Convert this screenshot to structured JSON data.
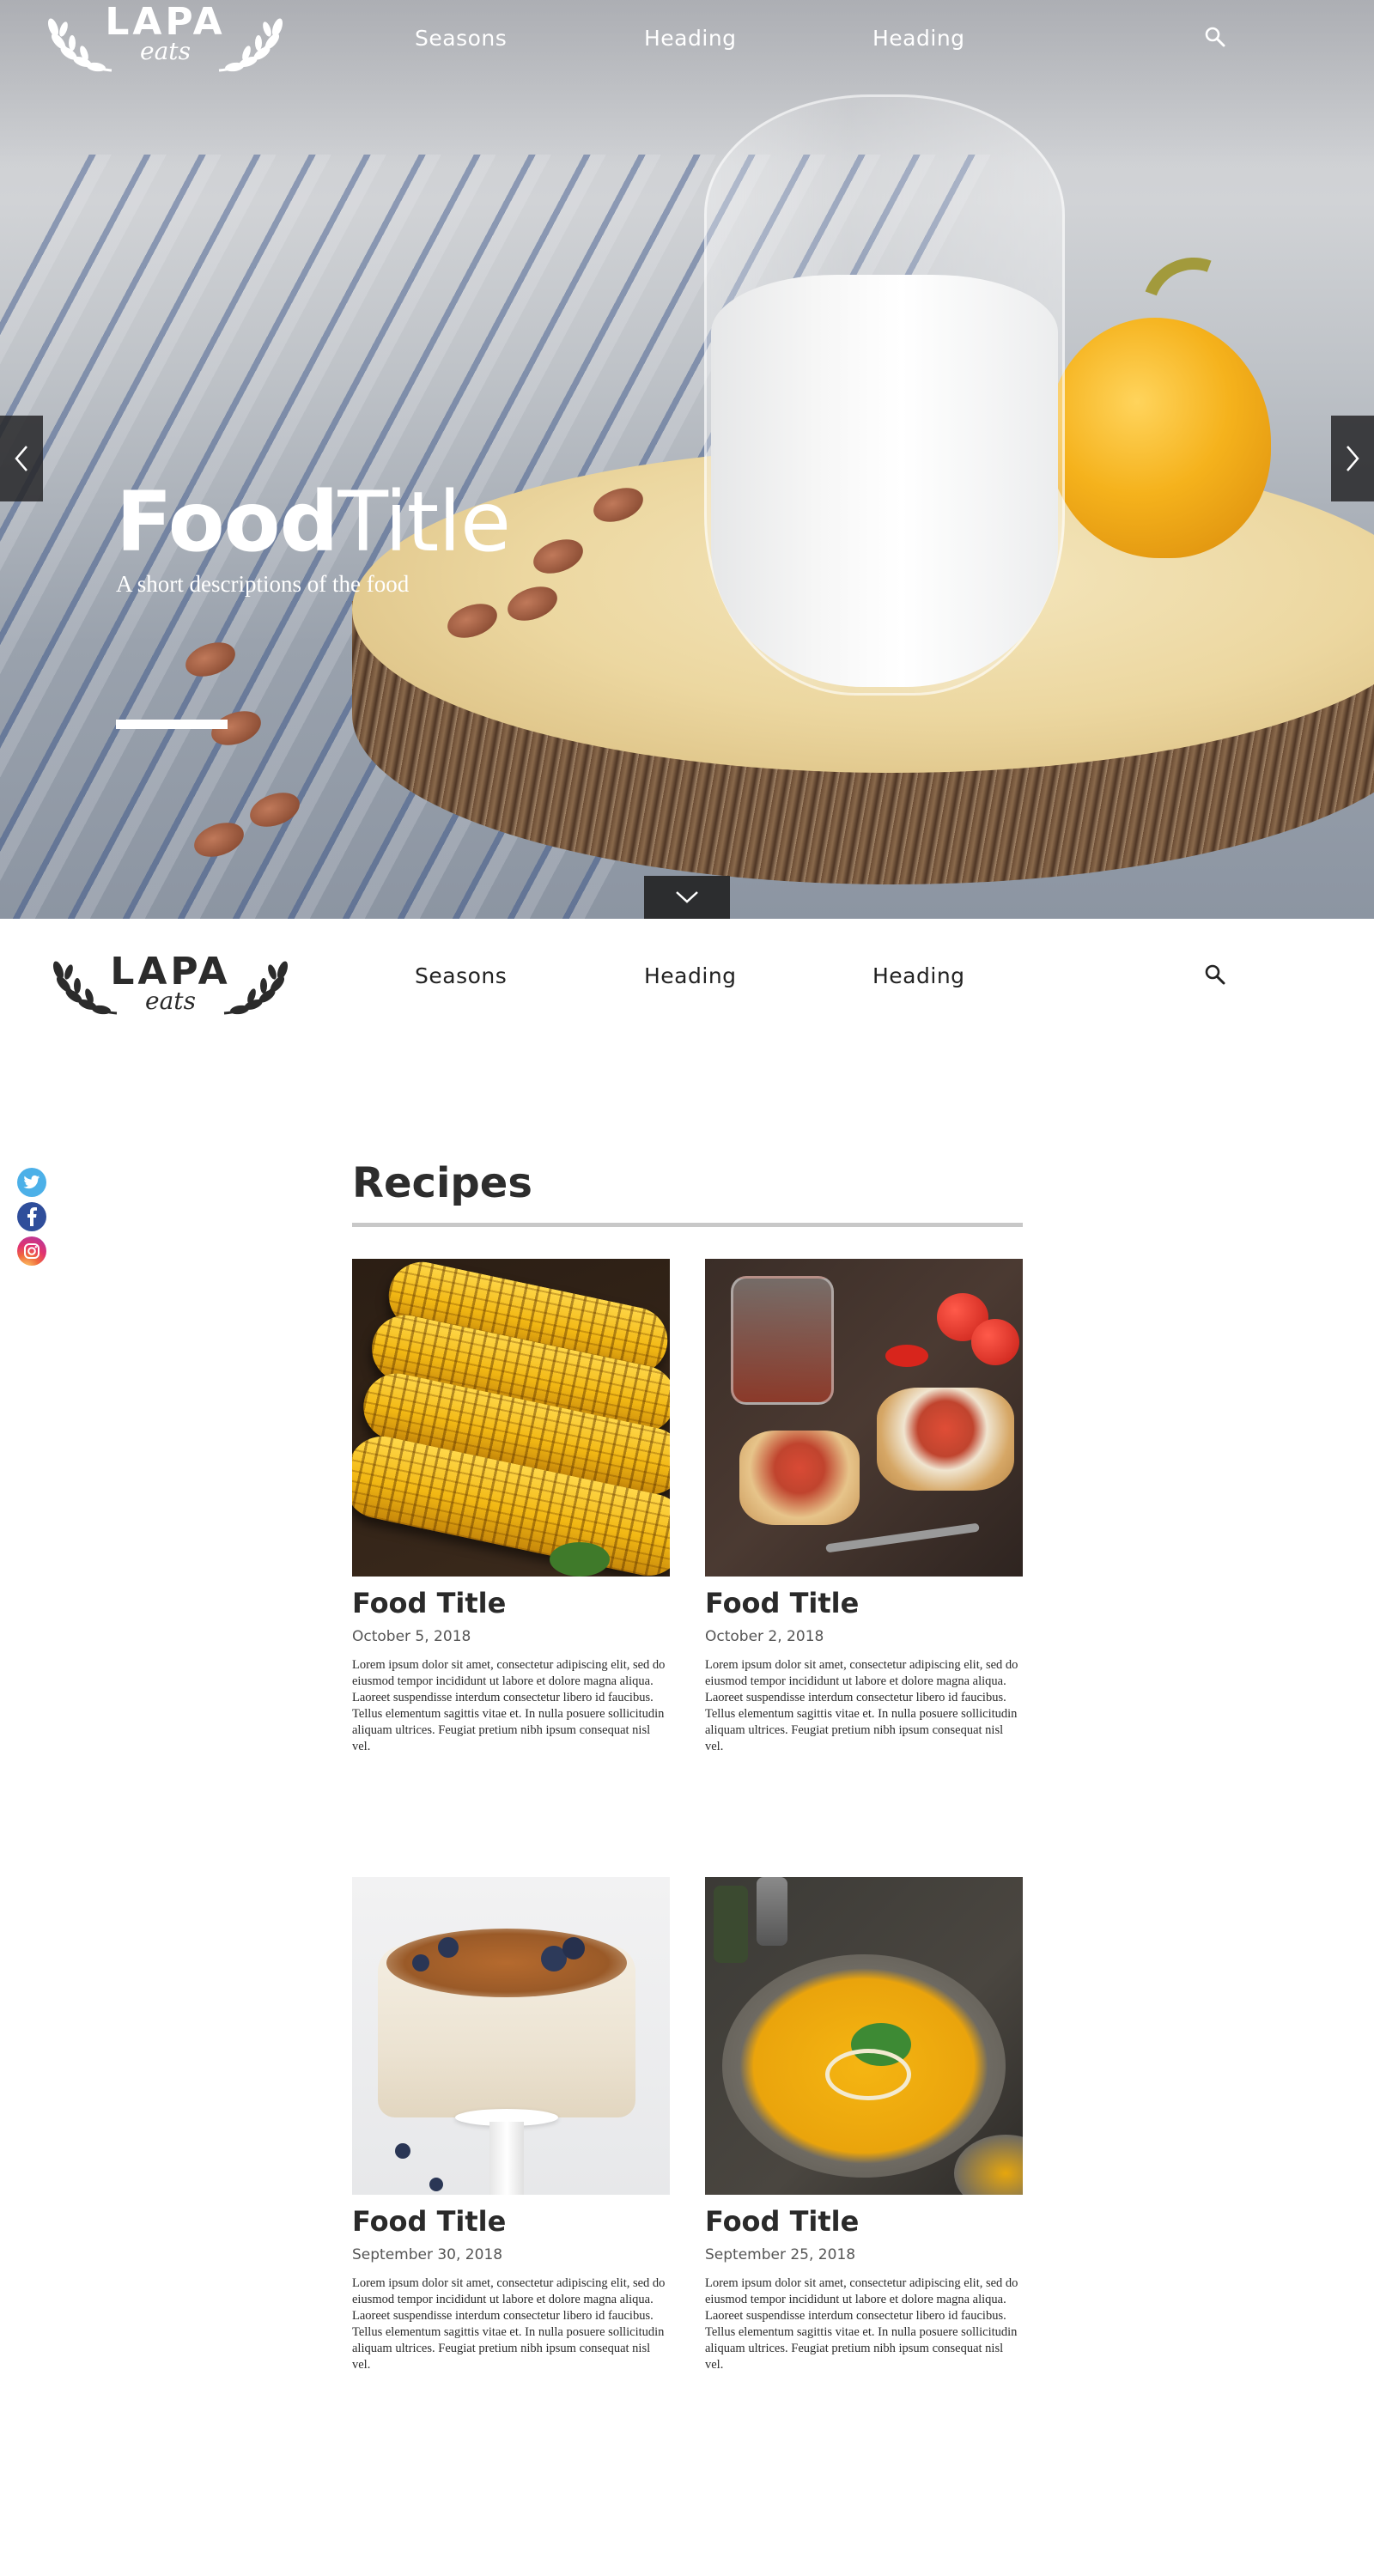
{
  "brand": {
    "name": "LAPA",
    "tagline": "eats"
  },
  "nav": {
    "items": [
      "Seasons",
      "Heading",
      "Heading"
    ]
  },
  "hero": {
    "title_bold": "Food",
    "title_light": "Title",
    "description": "A short descriptions of  the food"
  },
  "recipes": {
    "heading": "Recipes",
    "cards": [
      {
        "title": "Food Title",
        "date": "October 5, 2018",
        "image": "grilled-corn",
        "body": "Lorem ipsum dolor sit amet, consectetur adipiscing elit, sed do eiusmod tempor incididunt ut labore et dolore magna aliqua. Laoreet suspendisse interdum consectetur libero id faucibus. Tellus elementum sagittis vitae et. In nulla posuere sollicitudin aliquam ultrices. Feugiat pretium nibh ipsum consequat nisl vel."
      },
      {
        "title": "Food Title",
        "date": "October 2, 2018",
        "image": "bruschetta",
        "body": "Lorem ipsum dolor sit amet, consectetur adipiscing elit, sed do eiusmod tempor incididunt ut labore et dolore magna aliqua. Laoreet suspendisse interdum consectetur libero id faucibus. Tellus elementum sagittis vitae et. In nulla posuere sollicitudin aliquam ultrices. Feugiat pretium nibh ipsum consequat nisl vel."
      },
      {
        "title": "Food Title",
        "date": "September 30, 2018",
        "image": "blueberry-cake",
        "body": "Lorem ipsum dolor sit amet, consectetur adipiscing elit, sed do eiusmod tempor incididunt ut labore et dolore magna aliqua. Laoreet suspendisse interdum consectetur libero id faucibus. Tellus elementum sagittis vitae et. In nulla posuere sollicitudin aliquam ultrices. Feugiat pretium nibh ipsum consequat nisl vel."
      },
      {
        "title": "Food Title",
        "date": "September 25, 2018",
        "image": "pumpkin-soup",
        "body": "Lorem ipsum dolor sit amet, consectetur adipiscing elit, sed do eiusmod tempor incididunt ut labore et dolore magna aliqua. Laoreet suspendisse interdum consectetur libero id faucibus. Tellus elementum sagittis vitae et. In nulla posuere sollicitudin aliquam ultrices. Feugiat pretium nibh ipsum consequat nisl vel."
      }
    ]
  },
  "social": [
    "twitter-icon",
    "facebook-icon",
    "instagram-icon"
  ],
  "colors": {
    "twitter": "#4cb0e8",
    "facebook": "#2f4e9b",
    "instagram": "#e2336f",
    "dark_button": "#2c2d2f",
    "rule": "#c8c8c8"
  }
}
